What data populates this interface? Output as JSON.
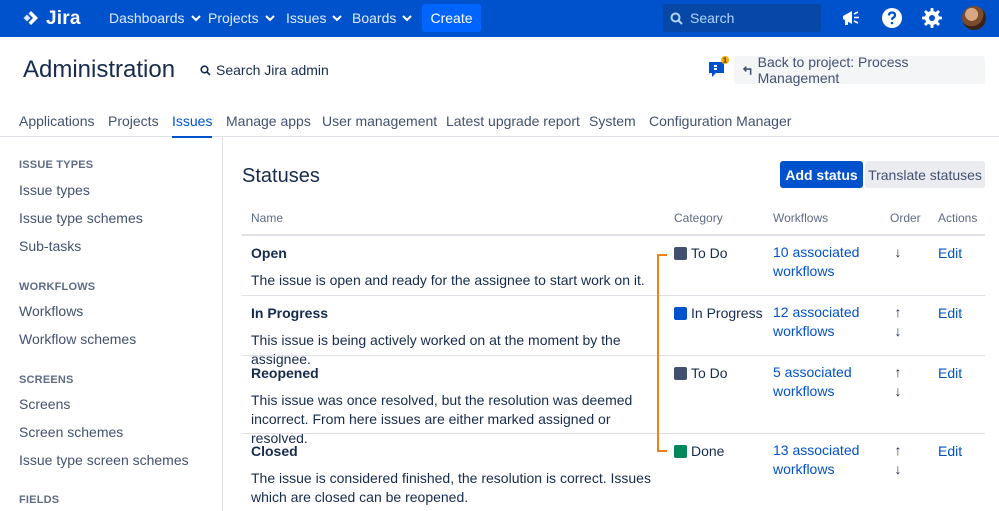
{
  "topnav": {
    "logo": "Jira",
    "items": [
      "Dashboards",
      "Projects",
      "Issues",
      "Boards"
    ],
    "create": "Create",
    "search_placeholder": "Search"
  },
  "header": {
    "title": "Administration",
    "admin_search": "Search Jira admin",
    "feedback_badge": "1",
    "back_button": "Back to project: Process Management"
  },
  "tabs": [
    "Applications",
    "Projects",
    "Issues",
    "Manage apps",
    "User management",
    "Latest upgrade report",
    "System",
    "Configuration Manager"
  ],
  "active_tab": "Issues",
  "sidebar": {
    "sections": [
      {
        "heading": "ISSUE TYPES",
        "items": [
          "Issue types",
          "Issue type schemes",
          "Sub-tasks"
        ]
      },
      {
        "heading": "WORKFLOWS",
        "items": [
          "Workflows",
          "Workflow schemes"
        ]
      },
      {
        "heading": "SCREENS",
        "items": [
          "Screens",
          "Screen schemes",
          "Issue type screen schemes"
        ]
      },
      {
        "heading": "FIELDS",
        "items": []
      }
    ]
  },
  "main": {
    "title": "Statuses",
    "add_status": "Add status",
    "translate_statuses": "Translate statuses",
    "columns": [
      "Name",
      "Category",
      "Workflows",
      "Order",
      "Actions"
    ],
    "rows": [
      {
        "name": "Open",
        "description": "The issue is open and ready for the assignee to start work on it.",
        "category": "To Do",
        "category_color": "#42526e",
        "workflows_line1": "10 associated",
        "workflows_line2": "workflows",
        "order_up": "",
        "order_down": "↓",
        "action": "Edit"
      },
      {
        "name": "In Progress",
        "description": "This issue is being actively worked on at the moment by the assignee.",
        "category": "In Progress",
        "category_color": "#0052cc",
        "workflows_line1": "12 associated",
        "workflows_line2": "workflows",
        "order_up": "↑",
        "order_down": "↓",
        "action": "Edit"
      },
      {
        "name": "Reopened",
        "description": "This issue was once resolved, but the resolution was deemed incorrect. From here issues are either marked assigned or resolved.",
        "category": "To Do",
        "category_color": "#42526e",
        "workflows_line1": "5 associated",
        "workflows_line2": "workflows",
        "order_up": "↑",
        "order_down": "↓",
        "action": "Edit"
      },
      {
        "name": "Closed",
        "description": "The issue is considered finished, the resolution is correct. Issues which are closed can be reopened.",
        "category": "Done",
        "category_color": "#00875a",
        "workflows_line1": "13 associated",
        "workflows_line2": "workflows",
        "order_up": "↑",
        "order_down": "↓",
        "action": "Edit"
      }
    ]
  },
  "colors": {
    "brand": "#0052cc",
    "annotation": "#f07f1c"
  }
}
